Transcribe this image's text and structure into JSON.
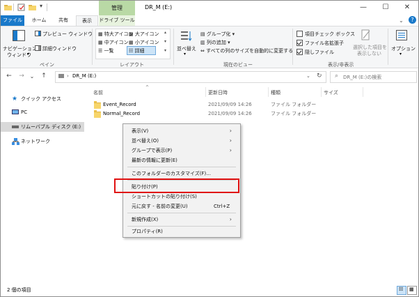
{
  "title": {
    "contextual_tab": "管理",
    "window_title": "DR_M (E:)",
    "minimize": "—",
    "maximize": "☐",
    "close": "✕"
  },
  "ribbon_tabs": [
    {
      "label": "ファイル"
    },
    {
      "label": "ホーム"
    },
    {
      "label": "共有"
    },
    {
      "label": "表示"
    },
    {
      "label": "ドライブ ツール"
    }
  ],
  "ribbon": {
    "pane_group": {
      "nav_pane_line1": "ナビゲーション",
      "nav_pane_line2": "ウィンドウ",
      "preview_pane": "プレビュー ウィンドウ",
      "details_pane": "詳細ウィンドウ",
      "group_label": "ペイン"
    },
    "layout_group": {
      "extra_large": "特大アイコン",
      "large": "大アイコン",
      "medium": "中アイコン",
      "small": "小アイコン",
      "list": "一覧",
      "details": "詳細",
      "group_label": "レイアウト"
    },
    "current_view_group": {
      "sort_by": "並べ替え",
      "group_by": "グループ化",
      "add_columns": "列の追加",
      "size_all_columns": "すべての列のサイズを自動的に変更する",
      "group_label": "現在のビュー"
    },
    "show_hide_group": {
      "item_checkboxes": "項目チェック ボックス",
      "file_extensions": "ファイル名拡張子",
      "hidden_items": "隠しファイル",
      "hide_selected_line1": "選択した項目を",
      "hide_selected_line2": "表示しない",
      "options": "オプション",
      "group_label": "表示/非表示",
      "item_checkboxes_checked": false,
      "file_extensions_checked": true,
      "hidden_items_checked": true
    }
  },
  "address": {
    "back": "←",
    "forward": "→",
    "recent": "⌄",
    "up": "↑",
    "path": "DR_M (E:)",
    "search_placeholder": "DR_M (E:)の検索"
  },
  "nav_pane": [
    {
      "label": "クイック アクセス",
      "icon": "star-icon"
    },
    {
      "label": "PC",
      "icon": "pc-icon"
    },
    {
      "label": "リムーバブル ディスク (E:)",
      "icon": "drive-icon",
      "selected": true
    },
    {
      "label": "ネットワーク",
      "icon": "network-icon"
    }
  ],
  "columns": {
    "name": "名前",
    "modified": "更新日時",
    "type": "種類",
    "size": "サイズ"
  },
  "files": [
    {
      "name": "Event_Record",
      "modified": "2021/09/09 14:26",
      "type": "ファイル フォルダー",
      "size": ""
    },
    {
      "name": "Normal_Record",
      "modified": "2021/09/09 14:26",
      "type": "ファイル フォルダー",
      "size": ""
    }
  ],
  "context_menu": {
    "view": "表示(V)",
    "sort_by": "並べ替え(O)",
    "group_by": "グループで表示(P)",
    "refresh": "最新の情報に更新(E)",
    "customize": "このフォルダーのカスタマイズ(F)...",
    "paste": "貼り付け(P)",
    "paste_shortcut": "ショートカットの貼り付け(S)",
    "undo_rename": "元に戻す - 名前の変更(U)",
    "undo_shortcut": "Ctrl+Z",
    "new": "新規作成(X)",
    "properties": "プロパティ(R)",
    "highlighted_item": "貼り付け(P)",
    "highlight_color": "#e01010"
  },
  "status": {
    "item_count": "2 個の項目"
  },
  "colors": {
    "file_tab": "#1979ca",
    "contextual_tab": "#b9d9a5",
    "folder": "#f7d56b"
  }
}
